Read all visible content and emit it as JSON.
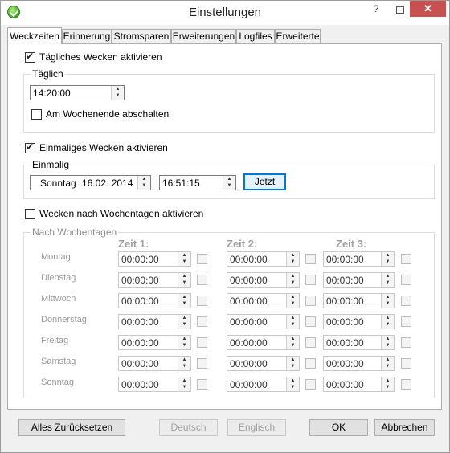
{
  "window": {
    "title": "Einstellungen",
    "help_glyph": "?",
    "close_glyph": "✕"
  },
  "tabs": [
    "Weckzeiten",
    "Erinnerung",
    "Stromsparen",
    "Erweiterungen",
    "Logfiles",
    "Erweiterte"
  ],
  "daily": {
    "checkbox_label": "Tägliches Wecken aktivieren",
    "checked": true,
    "group_title": "Täglich",
    "time": "14:20:00",
    "weekend_label": "Am Wochenende abschalten",
    "weekend_checked": false
  },
  "once": {
    "checkbox_label": "Einmaliges Wecken aktivieren",
    "checked": true,
    "group_title": "Einmalig",
    "weekday": "Sonntag",
    "date": "16.02. 2014",
    "time": "16:51:15",
    "now_button": "Jetzt"
  },
  "weekdays": {
    "checkbox_label": "Wecken nach Wochentagen aktivieren",
    "checked": false,
    "group_title": "Nach Wochentagen",
    "columns": [
      "Zeit 1:",
      "Zeit 2:",
      "Zeit 3:"
    ],
    "rows": [
      {
        "day": "Montag",
        "times": [
          "00:00:00",
          "00:00:00",
          "00:00:00"
        ]
      },
      {
        "day": "Dienstag",
        "times": [
          "00:00:00",
          "00:00:00",
          "00:00:00"
        ]
      },
      {
        "day": "Mittwoch",
        "times": [
          "00:00:00",
          "00:00:00",
          "00:00:00"
        ]
      },
      {
        "day": "Donnerstag",
        "times": [
          "00:00:00",
          "00:00:00",
          "00:00:00"
        ]
      },
      {
        "day": "Freitag",
        "times": [
          "00:00:00",
          "00:00:00",
          "00:00:00"
        ]
      },
      {
        "day": "Samstag",
        "times": [
          "00:00:00",
          "00:00:00",
          "00:00:00"
        ]
      },
      {
        "day": "Sonntag",
        "times": [
          "00:00:00",
          "00:00:00",
          "00:00:00"
        ]
      }
    ]
  },
  "footer": {
    "reset": "Alles Zurücksetzen",
    "german": "Deutsch",
    "english": "Englisch",
    "ok": "OK",
    "cancel": "Abbrechen"
  },
  "colors": {
    "accent": "#0078d7",
    "close_button": "#c75050",
    "app_icon": "#3ea320"
  }
}
